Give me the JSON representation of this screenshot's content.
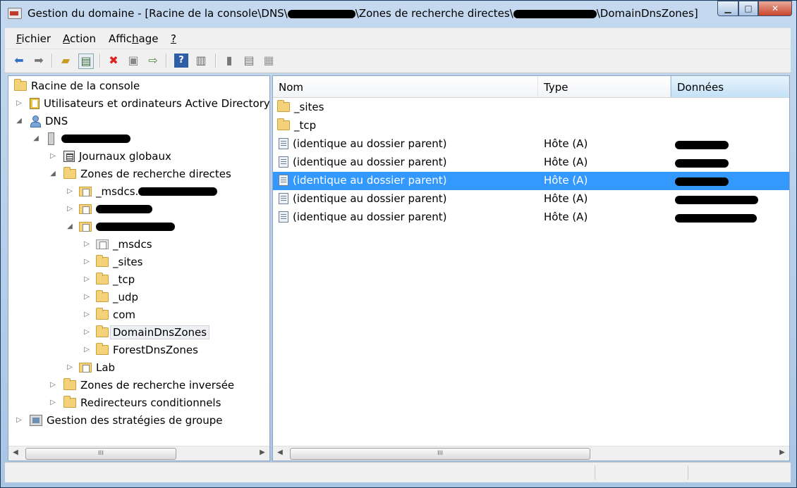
{
  "window": {
    "title_prefix": "Gestion du domaine - [Racine de la console\\DNS\\",
    "title_mid": "\\Zones de recherche directes\\",
    "title_suffix": "\\DomainDnsZones]",
    "buttons": {
      "minimize": "▁",
      "maximize": "□",
      "close": "✕"
    }
  },
  "menu": [
    {
      "label": "Fichier",
      "key": "F",
      "rest": "ichier"
    },
    {
      "label": "Action",
      "key": "A",
      "rest": "ction"
    },
    {
      "label": "Affichage",
      "pre": "Affic",
      "key": "h",
      "rest": "age"
    },
    {
      "label": "?",
      "key": "?",
      "rest": ""
    }
  ],
  "toolbar": {
    "icons": [
      "back-icon",
      "forward-icon",
      "up-folder-icon",
      "show-hide-tree-icon",
      "delete-icon",
      "properties-icon",
      "export-list-icon",
      "help-icon",
      "console-icon",
      "view-icon",
      "details-icon",
      "filter-icon"
    ]
  },
  "tree": {
    "root": "Racine de la console",
    "ad_users": "Utilisateurs et ordinateurs Active Directory",
    "dns": "DNS",
    "journals": "Journaux globaux",
    "forward_zones": "Zones de recherche directes",
    "msdcs_zone": "_msdcs.",
    "sub_msdcs": "_msdcs",
    "sub_sites": "_sites",
    "sub_tcp": "_tcp",
    "sub_udp": "_udp",
    "sub_com": "com",
    "sub_domaindns": "DomainDnsZones",
    "sub_forestdns": "ForestDnsZones",
    "lab": "Lab",
    "reverse_zones": "Zones de recherche inversée",
    "conditional_forwarders": "Redirecteurs conditionnels",
    "gpo": "Gestion des stratégies de groupe"
  },
  "list": {
    "columns": [
      "Nom",
      "Type",
      "Données"
    ],
    "rows": [
      {
        "name": "_sites",
        "type": "",
        "icon": "folder"
      },
      {
        "name": "_tcp",
        "type": "",
        "icon": "folder"
      },
      {
        "name": "(identique au dossier parent)",
        "type": "Hôte (A)",
        "icon": "record"
      },
      {
        "name": "(identique au dossier parent)",
        "type": "Hôte (A)",
        "icon": "record"
      },
      {
        "name": "(identique au dossier parent)",
        "type": "Hôte (A)",
        "icon": "record",
        "selected": true
      },
      {
        "name": "(identique au dossier parent)",
        "type": "Hôte (A)",
        "icon": "record"
      },
      {
        "name": "(identique au dossier parent)",
        "type": "Hôte (A)",
        "icon": "record"
      }
    ]
  },
  "scroll": {
    "grip": "III",
    "left": "◀",
    "right": "▶"
  }
}
